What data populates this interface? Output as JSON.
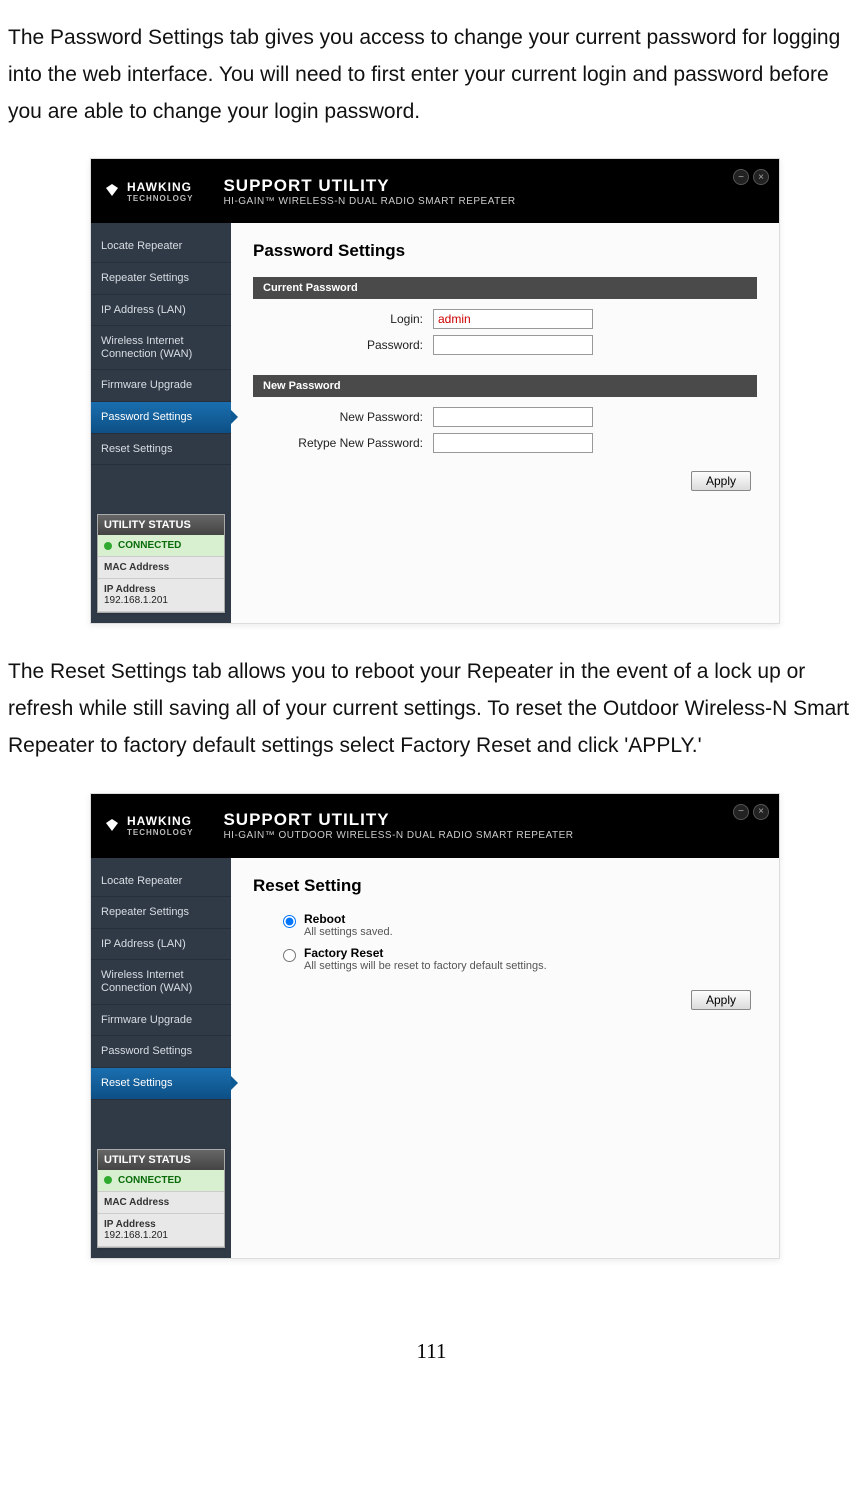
{
  "doc": {
    "para1": "The Password Settings tab gives you access to change your current password for logging into the web interface.   You will need to first enter your current login and password before you are able to change your login password.",
    "para2": "The Reset Settings tab allows you to reboot your Repeater in the event of a lock up or refresh while still saving all of your current settings.   To reset the Outdoor Wireless-N Smart Repeater to factory default settings select Factory Reset and click 'APPLY.'",
    "page_number": "111"
  },
  "brand_name": "HAWKING",
  "brand_sub": "TECHNOLOGY",
  "header_title": "SUPPORT UTILITY",
  "nav_items": [
    "Locate Repeater",
    "Repeater Settings",
    "IP Address (LAN)",
    "Wireless Internet Connection (WAN)",
    "Firmware Upgrade",
    "Password Settings",
    "Reset Settings"
  ],
  "status": {
    "title": "UTILITY STATUS",
    "connected": "CONNECTED",
    "mac_label": "MAC Address",
    "ip_label": "IP Address",
    "ip_value": "192.168.1.201"
  },
  "apply_label": "Apply",
  "panel1": {
    "header_subtitle": "HI-GAIN™ WIRELESS-N DUAL RADIO SMART REPEATER",
    "page_title": "Password Settings",
    "section1": "Current Password",
    "login_label": "Login:",
    "login_value": "admin",
    "password_label": "Password:",
    "section2": "New Password",
    "newpw_label": "New Password:",
    "retypepw_label": "Retype New Password:"
  },
  "panel2": {
    "header_subtitle": "HI-GAIN™ OUTDOOR WIRELESS-N DUAL RADIO SMART REPEATER",
    "page_title": "Reset Setting",
    "opt1_label": "Reboot",
    "opt1_desc": "All settings saved.",
    "opt2_label": "Factory Reset",
    "opt2_desc": "All settings will be reset to factory default settings."
  }
}
